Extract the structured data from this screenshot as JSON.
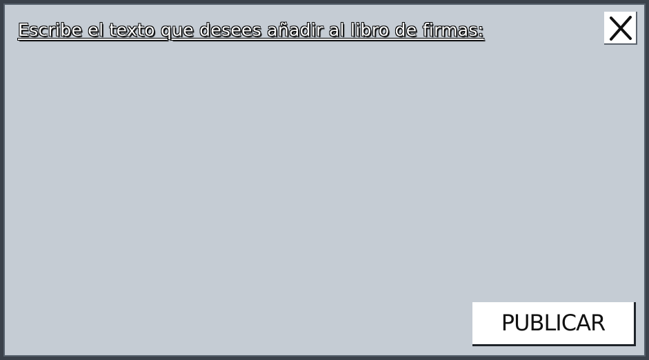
{
  "dialog": {
    "title": "Escribe el texto que desees añadir al libro de firmas:",
    "textarea_value": "",
    "close_icon": "close-icon",
    "publish_label": "PUBLICAR"
  },
  "colors": {
    "panel_background": "#c5ccd4",
    "border": "#3b424b",
    "button_background": "#ffffff",
    "title_text": "#ffffff"
  }
}
